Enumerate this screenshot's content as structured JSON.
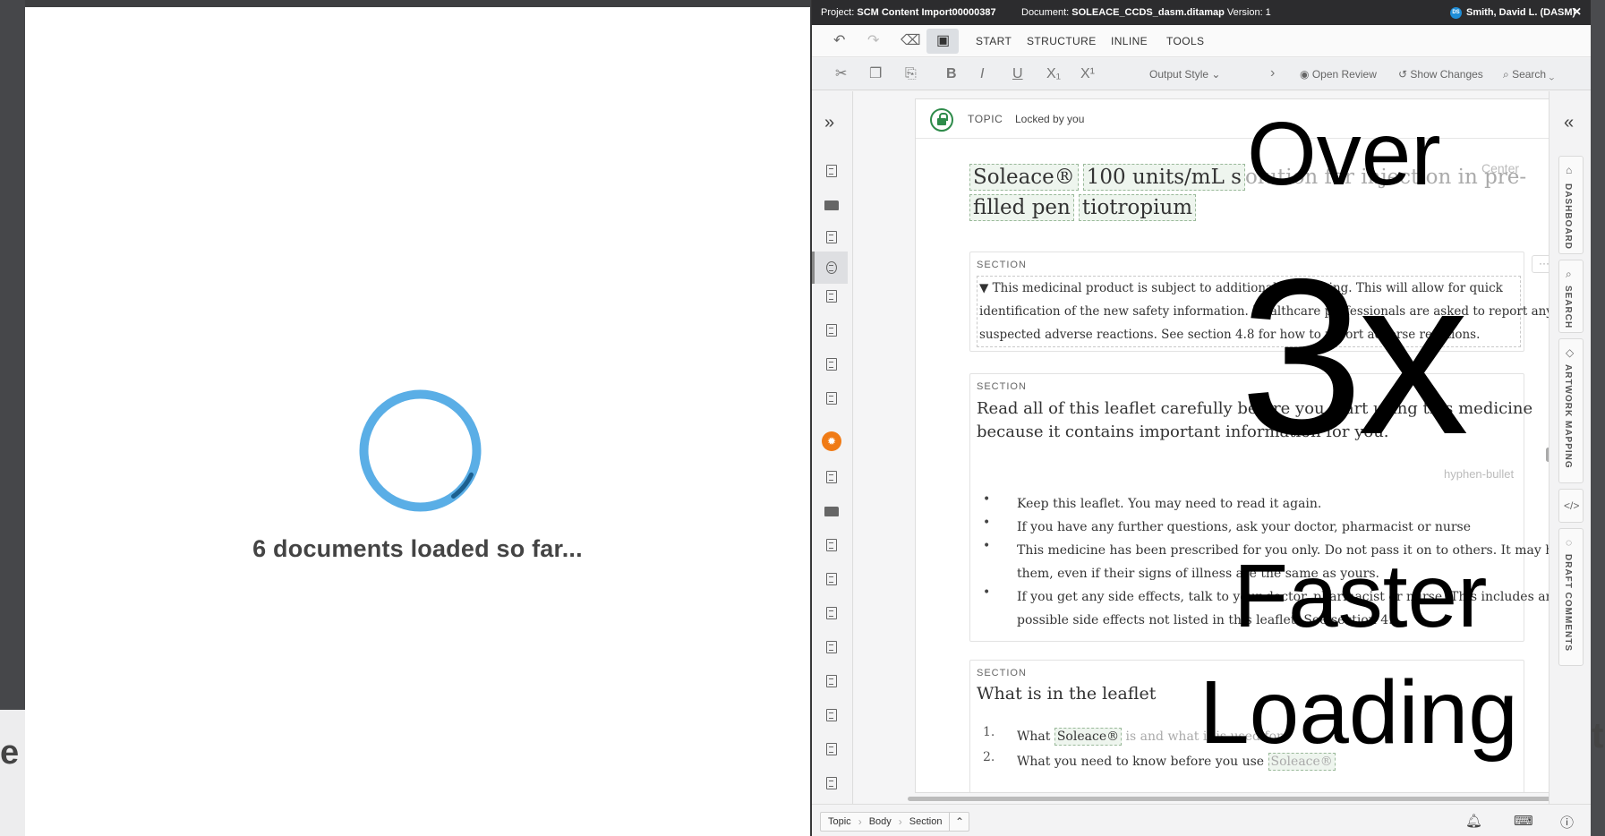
{
  "loading": {
    "message": "6 documents loaded so far...",
    "progress_fraction": 0.08
  },
  "titlebar": {
    "project_label": "Project:",
    "project_value": "SCM Content Import00000387",
    "document_label": "Document:",
    "document_value": "SOLEACE_CCDS_dasm.ditamap",
    "version": "Version: 1",
    "user_initials": "DS",
    "user_name": "Smith, David L. (DASM)"
  },
  "menu": {
    "tabs": [
      "START",
      "STRUCTURE",
      "INLINE",
      "TOOLS"
    ]
  },
  "toolbar": {
    "output_style": "Output Style",
    "open_review": "Open Review",
    "show_changes": "Show Changes",
    "search": "Search"
  },
  "topic": {
    "type": "TOPIC",
    "lock_status": "Locked by you",
    "align_label": "Center",
    "title_chips": [
      "Soleace®",
      "100 units/mL s"
    ],
    "title_rest": "olution for injection in pre-",
    "title_line2_chips": [
      "filled pen",
      "tiotropium"
    ]
  },
  "sections": [
    {
      "label": "SECTION",
      "lines": [
        "▼ This medicinal product is subject to additional monitoring. This will allow for quick",
        "identification of the new safety information. Healthcare professionals are asked to report any",
        "suspected adverse reactions. See section 4.8 for how to report adverse reactions."
      ]
    },
    {
      "label": "SECTION",
      "heading_lines": [
        "Read all of this leaflet carefully before you start using this medicine",
        "because it contains important information for you."
      ],
      "list_style": "hyphen-bullet",
      "bullets": [
        "Keep this leaflet. You may need to read it again.",
        "If you have any further questions, ask your doctor, pharmacist or nurse",
        "This medicine has been prescribed for you only. Do not pass it on to others. It may harm",
        "them, even if their signs of illness are the same as yours.",
        "If you get any side effects, talk to your doctor, pharmacist or nurse. This includes any",
        "possible side effects not listed in this leaflet. See section 4."
      ]
    },
    {
      "label": "SECTION",
      "heading": "What is in the leaflet",
      "items": [
        {
          "n": "1.",
          "pre": "What ",
          "chip": "Soleace®",
          "post": " is and what it is used for"
        },
        {
          "n": "2.",
          "pre": "What you need to know before you use ",
          "chip": "Soleace®",
          "post": ""
        }
      ]
    }
  ],
  "right_tabs": [
    "DASHBOARD",
    "SEARCH",
    "ARTWORK MAPPING",
    "DRAFT COMMENTS"
  ],
  "breadcrumb": [
    "Topic",
    "Body",
    "Section"
  ],
  "overlay": {
    "line1": "Over",
    "line2": "3x",
    "line3": "Faster",
    "line4": "Loading"
  },
  "background": {
    "left_peek": "e e",
    "right_peek": "t"
  },
  "colors": {
    "spinner": "#5aaee6",
    "spinner_arc": "#1b5f8f",
    "accent_green": "#2e8b4a",
    "orange": "#f07b16"
  }
}
